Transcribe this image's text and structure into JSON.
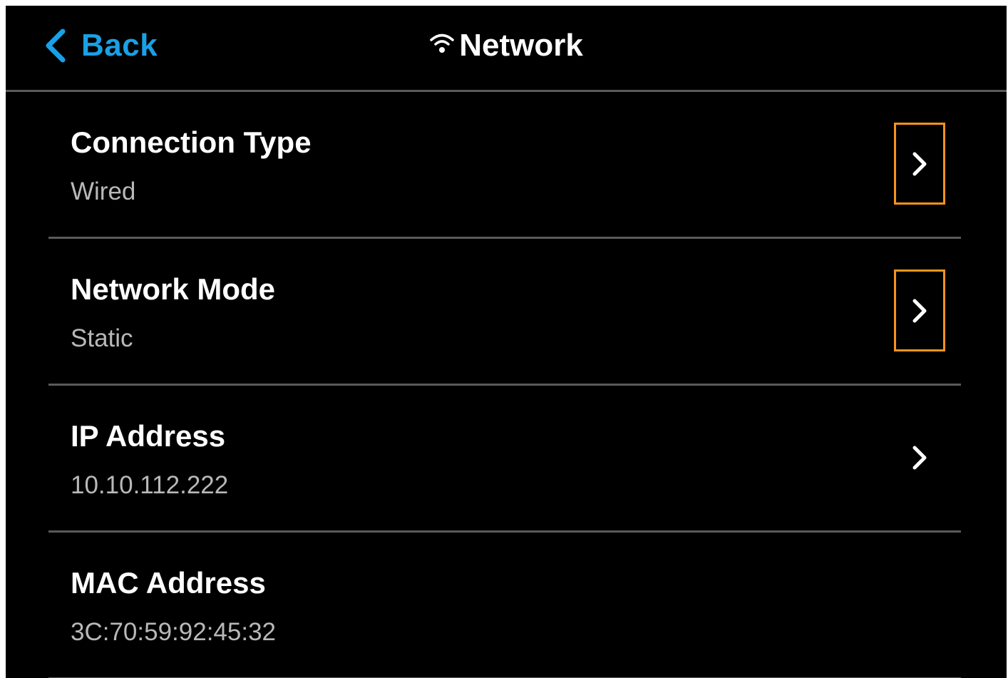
{
  "header": {
    "back_label": "Back",
    "title": "Network",
    "back_icon": "chevron-left-icon",
    "title_icon": "wifi-icon"
  },
  "colors": {
    "background": "#000000",
    "accent": "#1aa0e6",
    "highlight": "#f7931e",
    "divider": "#5a5a5a",
    "value_text": "#b8b8b8"
  },
  "settings": [
    {
      "title": "Connection Type",
      "value": "Wired",
      "has_arrow": true,
      "highlighted": true
    },
    {
      "title": "Network Mode",
      "value": "Static",
      "has_arrow": true,
      "highlighted": true
    },
    {
      "title": "IP Address",
      "value": "10.10.112.222",
      "has_arrow": true,
      "highlighted": false
    },
    {
      "title": "MAC Address",
      "value": "3C:70:59:92:45:32",
      "has_arrow": false,
      "highlighted": false
    }
  ]
}
